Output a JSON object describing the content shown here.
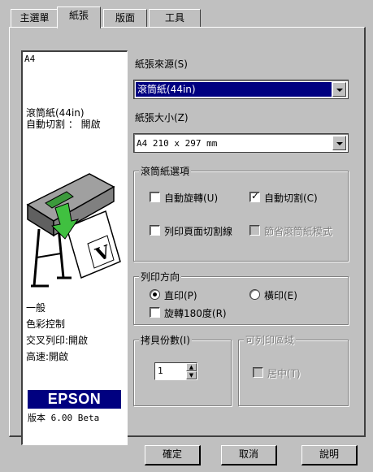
{
  "tabs": [
    {
      "label": "主選單"
    },
    {
      "label": "紙張"
    },
    {
      "label": "版面"
    },
    {
      "label": "工具"
    }
  ],
  "preview": {
    "paper_size": "A4",
    "roll_info_1": "滾筒紙(44in)",
    "roll_info_2": "自動切割 ： 開啟",
    "mode": "一般",
    "color": "色彩控制",
    "collate": "交叉列印:開啟",
    "speed": "高速:開啟",
    "logo_text": "EPSON",
    "version": "版本 6.00 Beta"
  },
  "paper_source": {
    "label": "紙張來源(S)",
    "value": "滾筒紙(44in)"
  },
  "paper_size": {
    "label": "紙張大小(Z)",
    "value": "A4 210 x 297 mm"
  },
  "roll_options": {
    "title": "滾筒紙選項",
    "auto_rotate": {
      "label": "自動旋轉(U)",
      "checked": false
    },
    "auto_cut": {
      "label": "自動切割(C)",
      "checked": true
    },
    "page_line": {
      "label": "列印頁面切割線",
      "checked": false
    },
    "save_roll": {
      "label": "節省滾筒紙模式",
      "checked": false,
      "enabled": false
    }
  },
  "orientation": {
    "title": "列印方向",
    "portrait": {
      "label": "直印(P)",
      "selected": true
    },
    "landscape": {
      "label": "橫印(E)",
      "selected": false
    },
    "rotate180": {
      "label": "旋轉180度(R)",
      "checked": false
    }
  },
  "copies": {
    "title": "拷貝份數(I)",
    "value": "1"
  },
  "printable": {
    "title": "可列印區域",
    "center": {
      "label": "居中(T)",
      "checked": false,
      "enabled": false
    }
  },
  "buttons": {
    "ok": "確定",
    "cancel": "取消",
    "help": "說明"
  },
  "colors": {
    "face": "#c0c0c0",
    "selection": "#000080",
    "logo_bg": "#000080"
  }
}
